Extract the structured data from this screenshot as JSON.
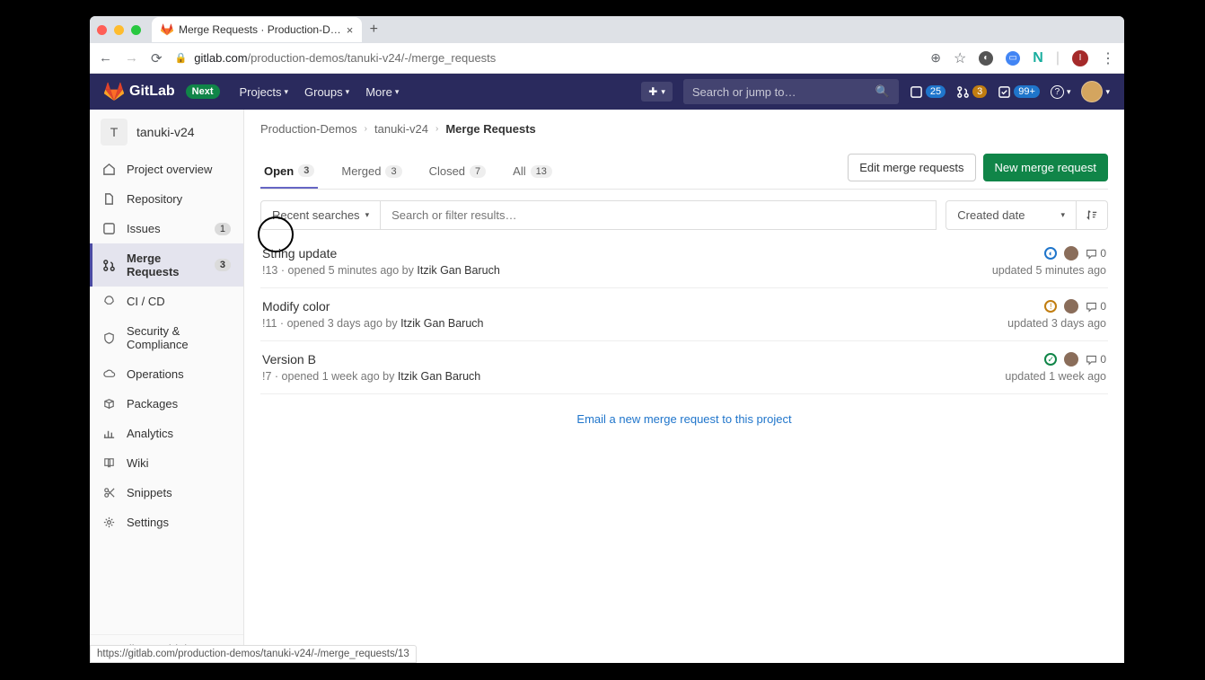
{
  "browser": {
    "tab_title": "Merge Requests · Production-D…",
    "url_host": "gitlab.com",
    "url_path": "/production-demos/tanuki-v24/-/merge_requests",
    "avatar_letter": "I",
    "status_url": "https://gitlab.com/production-demos/tanuki-v24/-/merge_requests/13"
  },
  "navbar": {
    "brand": "GitLab",
    "next": "Next",
    "links": {
      "projects": "Projects",
      "groups": "Groups",
      "more": "More"
    },
    "search_placeholder": "Search or jump to…",
    "issues_count": "25",
    "mr_count": "3",
    "todo_count": "99+"
  },
  "sidebar": {
    "project_letter": "T",
    "project_name": "tanuki-v24",
    "items": [
      {
        "label": "Project overview"
      },
      {
        "label": "Repository"
      },
      {
        "label": "Issues",
        "badge": "1"
      },
      {
        "label": "Merge Requests",
        "badge": "3"
      },
      {
        "label": "CI / CD"
      },
      {
        "label": "Security & Compliance"
      },
      {
        "label": "Operations"
      },
      {
        "label": "Packages"
      },
      {
        "label": "Analytics"
      },
      {
        "label": "Wiki"
      },
      {
        "label": "Snippets"
      },
      {
        "label": "Settings"
      }
    ],
    "collapse": "Collapse sidebar"
  },
  "breadcrumb": {
    "a": "Production-Demos",
    "b": "tanuki-v24",
    "c": "Merge Requests"
  },
  "tabs": {
    "open": {
      "label": "Open",
      "count": "3"
    },
    "merged": {
      "label": "Merged",
      "count": "3"
    },
    "closed": {
      "label": "Closed",
      "count": "7"
    },
    "all": {
      "label": "All",
      "count": "13"
    }
  },
  "actions": {
    "edit": "Edit merge requests",
    "new": "New merge request"
  },
  "filter": {
    "recent": "Recent searches",
    "placeholder": "Search or filter results…",
    "sort": "Created date"
  },
  "mrs": [
    {
      "title": "String update",
      "ref": "!13",
      "opened": "opened 5 minutes ago by",
      "author": "Itzik Gan Baruch",
      "comments": "0",
      "updated": "updated 5 minutes ago",
      "pipe": "running"
    },
    {
      "title": "Modify color",
      "ref": "!11",
      "opened": "opened 3 days ago by",
      "author": "Itzik Gan Baruch",
      "comments": "0",
      "updated": "updated 3 days ago",
      "pipe": "warn"
    },
    {
      "title": "Version B",
      "ref": "!7",
      "opened": "opened 1 week ago by",
      "author": "Itzik Gan Baruch",
      "comments": "0",
      "updated": "updated 1 week ago",
      "pipe": "ok"
    }
  ],
  "email_link": "Email a new merge request to this project"
}
